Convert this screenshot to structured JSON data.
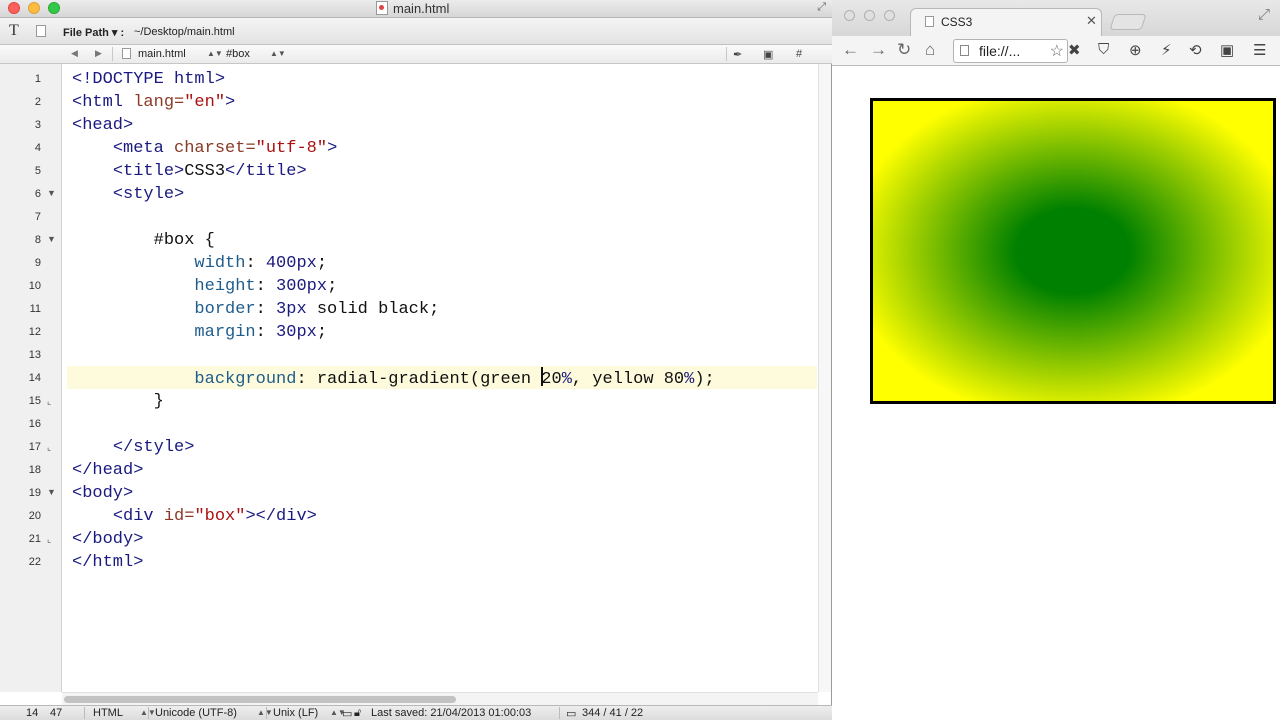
{
  "editor": {
    "title": "main.html",
    "toolbar": {
      "file_path_label": "File Path ▾ :",
      "file_path": "~/Desktop/main.html"
    },
    "navbar": {
      "file": "main.html",
      "symbol": "#box",
      "markers_icon": "✒",
      "doc_icon": "▣",
      "hash_icon": "#"
    },
    "line_numbers": [
      "1",
      "2",
      "3",
      "4",
      "5",
      "6",
      "7",
      "8",
      "9",
      "10",
      "11",
      "12",
      "13",
      "14",
      "15",
      "16",
      "17",
      "18",
      "19",
      "20",
      "21",
      "22"
    ],
    "code": {
      "l1_tag": "<!DOCTYPE html>",
      "l2_open": "<html ",
      "l2_attr": "lang=",
      "l2_val": "\"en\"",
      "l2_close": ">",
      "l3": "<head>",
      "l4_open": "<meta ",
      "l4_attr": "charset=",
      "l4_val": "\"utf-8\"",
      "l4_close": ">",
      "l5_open": "<title>",
      "l5_text": "CSS3",
      "l5_close": "</title>",
      "l6": "<style>",
      "l8": "#box {",
      "l9_prop": "width",
      "l9_rest": ": ",
      "l9_num": "400px",
      "l9_end": ";",
      "l10_prop": "height",
      "l10_rest": ": ",
      "l10_num": "300px",
      "l10_end": ";",
      "l11_prop": "border",
      "l11_rest": ": ",
      "l11_num": "3px",
      "l11_end": " solid black;",
      "l12_prop": "margin",
      "l12_rest": ": ",
      "l12_num": "30px",
      "l12_end": ";",
      "l14_prop": "background",
      "l14_a": ": radial-gradient(green ",
      "l14_b": "20",
      "l14_c": "%",
      "l14_d": ", yellow ",
      "l14_e": "80",
      "l14_f": "%",
      "l14_g": ");",
      "l15": "}",
      "l17": "</style>",
      "l18": "</head>",
      "l19": "<body>",
      "l20_open": "<div ",
      "l20_attr": "id=",
      "l20_val": "\"box\"",
      "l20_close": "></div>",
      "l21": "</body>",
      "l22": "</html>"
    },
    "status": {
      "line": "14",
      "column": "47",
      "syntax": "HTML",
      "encoding": "Unicode (UTF-8)",
      "line_endings": "Unix (LF)",
      "last_saved": "Last saved: 21/04/2013 01:00:03",
      "counts": "344 / 41 / 22"
    }
  },
  "browser": {
    "tab_title": "CSS3",
    "address": "file://...",
    "box_colors": {
      "inner": "green",
      "outer": "yellow",
      "border": "#000000"
    }
  }
}
